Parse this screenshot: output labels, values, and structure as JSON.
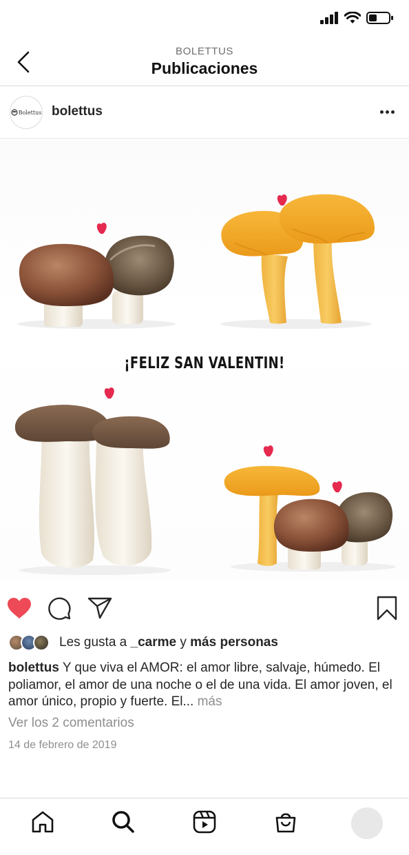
{
  "header": {
    "subtitle": "BOLETTUS",
    "title": "Publicaciones"
  },
  "post": {
    "username": "bolettus",
    "avatar_text": "Bolettus",
    "image_text": "¡FELIZ SAN VALENTIN!",
    "liked": true,
    "likes": {
      "prefix": "Les gusta a",
      "user": "_carme",
      "joiner": "y",
      "others": "más personas"
    },
    "caption": {
      "user": "bolettus",
      "text": "Y que viva el AMOR: el amor libre, salvaje, húmedo. El poliamor, el amor de una noche o el de una vida. El amor joven, el amor único, propio y fuerte. El...",
      "more": "más"
    },
    "comments_link": "Ver los 2 comentarios",
    "date": "14 de febrero de 2019"
  },
  "icons": {
    "back": "chevron-left-icon",
    "more": "more-horizontal-icon",
    "like": "heart-icon",
    "comment": "comment-icon",
    "share": "send-icon",
    "save": "bookmark-icon",
    "home": "home-icon",
    "search": "search-icon",
    "reels": "reels-icon",
    "shop": "shop-icon"
  },
  "colors": {
    "like": "#ed4956",
    "text": "#262626",
    "muted": "#8e8e8e",
    "heart_accent": "#e5294f"
  }
}
